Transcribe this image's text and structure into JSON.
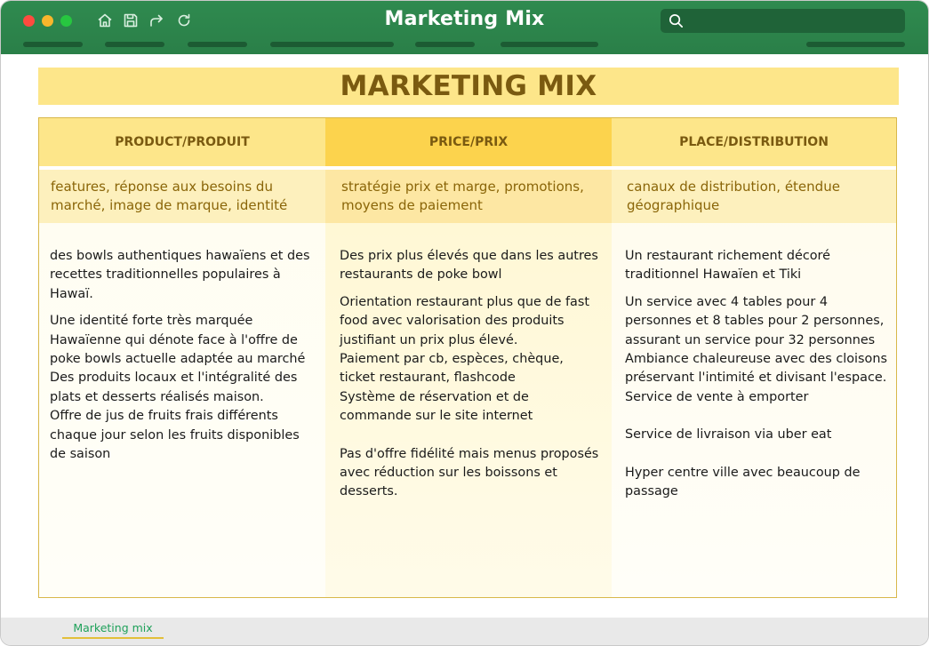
{
  "window": {
    "title": "Marketing Mix",
    "search_placeholder": ""
  },
  "toolbar": {
    "icons": [
      "home-icon",
      "save-icon",
      "redo-icon",
      "refresh-icon"
    ]
  },
  "document": {
    "title": "MARKETING MIX",
    "columns": [
      {
        "header": "PRODUCT/PRODUIT",
        "subtitle": "features, réponse aux besoins du marché, image de marque, identité",
        "paragraphs": [
          "des bowls authentiques hawaïens et des recettes traditionnelles populaires à Hawaï.",
          "Une identité forte très marquée Hawaïenne qui dénote face à l'offre de poke bowls actuelle adaptée au marché\nDes produits locaux et l'intégralité des plats et desserts réalisés maison.\nOffre de jus de fruits frais différents chaque jour selon les fruits disponibles de saison"
        ]
      },
      {
        "header": "PRICE/PRIX",
        "subtitle": "stratégie prix et marge, promotions, moyens de paiement",
        "paragraphs": [
          "Des prix plus élevés que dans les autres restaurants de poke bowl",
          "Orientation restaurant plus que de fast food avec valorisation des produits justifiant un prix plus élevé.\nPaiement par cb, espèces, chèque, ticket restaurant, flashcode\nSystème de réservation et de commande sur le site internet",
          "Pas d'offre fidélité mais menus proposés avec réduction sur les boissons et desserts."
        ]
      },
      {
        "header": "PLACE/DISTRIBUTION",
        "subtitle": "canaux de distribution, étendue géographique",
        "paragraphs": [
          "Un restaurant richement décoré traditionnel Hawaïen et Tiki",
          "Un service avec 4 tables pour 4 personnes et 8 tables pour 2 personnes, assurant un service pour 32 personnes\nAmbiance chaleureuse avec des cloisons préservant l'intimité et divisant l'espace.\nService de vente à emporter",
          "Service de livraison via uber eat",
          "Hyper centre ville avec beaucoup de passage"
        ]
      }
    ]
  },
  "sheets": {
    "active": "Marketing mix"
  },
  "colors": {
    "titlebar": "#2f8a4f",
    "banner": "#fde68a",
    "header_accent": "#fcd34d",
    "text_gold": "#7a5a10"
  }
}
